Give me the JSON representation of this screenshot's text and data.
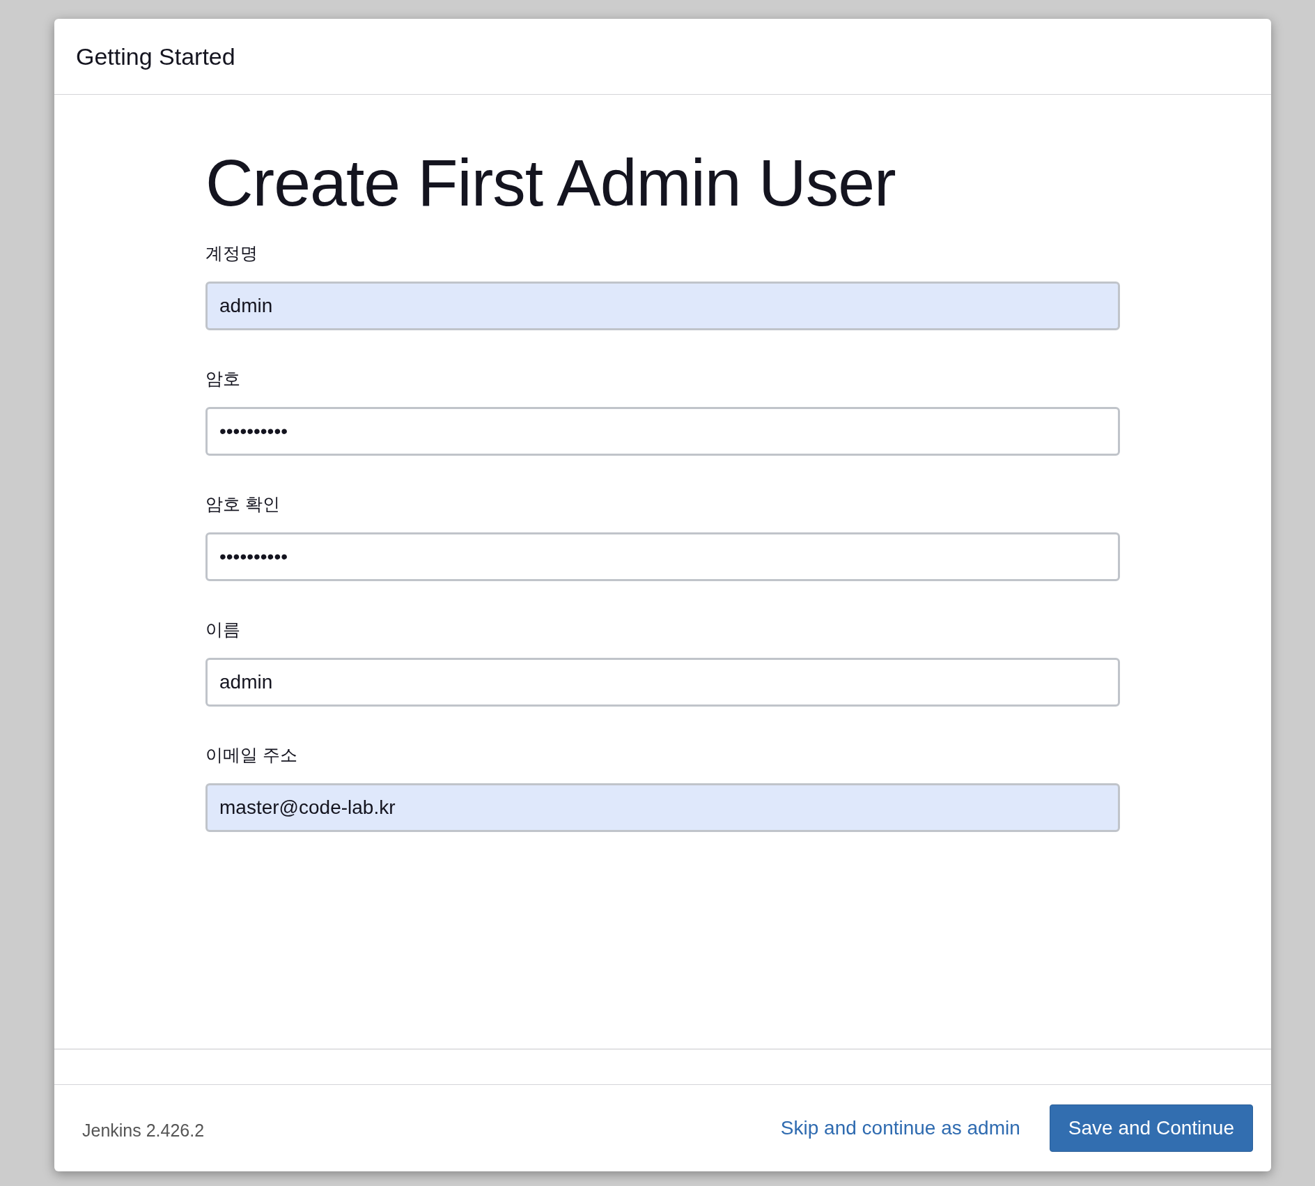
{
  "dialog": {
    "title": "Getting Started"
  },
  "heading": "Create First Admin User",
  "fields": [
    {
      "label": "계정명",
      "value": "admin",
      "autofilled": true
    },
    {
      "label": "암호",
      "value": "••••••••••",
      "autofilled": false
    },
    {
      "label": "암호 확인",
      "value": "••••••••••",
      "autofilled": false
    },
    {
      "label": "이름",
      "value": "admin",
      "autofilled": false
    },
    {
      "label": "이메일 주소",
      "value": "master@code-lab.kr",
      "autofilled": true
    }
  ],
  "footer": {
    "version": "Jenkins 2.426.2",
    "skip_link": "Skip and continue as admin",
    "save_button": "Save and Continue"
  }
}
